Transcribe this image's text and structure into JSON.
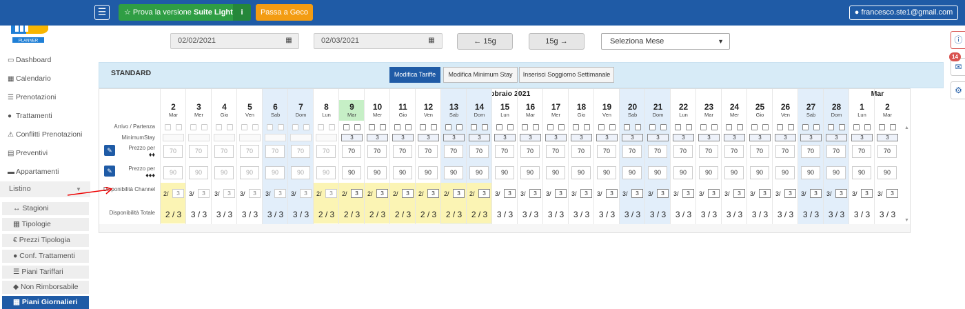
{
  "topbar": {
    "menu_icon": "hamburger-icon",
    "suite_label": "Prova la versione",
    "suite_strong": "Suite Light",
    "suite_info_icon": "info-icon",
    "geco_label": "Passa a Geco",
    "user_label": "francesco.ste1@gmail.com",
    "user_icon": "user-icon"
  },
  "sidebar": {
    "items": [
      {
        "icon": "monitor-icon",
        "label": "Dashboard"
      },
      {
        "icon": "calendar-icon",
        "label": "Calendario"
      },
      {
        "icon": "list-icon",
        "label": "Prenotazioni"
      },
      {
        "icon": "apple-icon",
        "label": "Trattamenti"
      },
      {
        "icon": "warning-icon",
        "label": "Conflitti Prenotazioni"
      },
      {
        "icon": "document-icon",
        "label": "Preventivi"
      },
      {
        "icon": "bed-icon",
        "label": "Appartamenti"
      }
    ],
    "listino_label": "Listino",
    "sub_items": [
      {
        "icon": "arrows-icon",
        "label": "Stagioni"
      },
      {
        "icon": "grid-icon",
        "label": "Tipologie"
      },
      {
        "icon": "euro-icon",
        "label": "Prezzi Tipologia"
      },
      {
        "icon": "apple-icon",
        "label": "Conf. Trattamenti"
      },
      {
        "icon": "list-icon",
        "label": "Piani Tariffari"
      },
      {
        "icon": "tag-icon",
        "label": "Non Rimborsabile"
      },
      {
        "icon": "grid-icon",
        "label": "Piani Giornalieri"
      }
    ]
  },
  "controls": {
    "date_from": "02/02/2021",
    "date_to": "02/03/2021",
    "prev_label": "15g",
    "next_label": "15g",
    "month_select": "Seleziona Mese"
  },
  "right_badge": "14",
  "panel": {
    "title": "STANDARD",
    "tab_modifica_tariffe": "Modifica Tariffe",
    "tab_min_stay": "Modifica Minimum Stay",
    "tab_soggiorno": "Inserisci Soggiorno Settimanale"
  },
  "grid": {
    "month_feb": "Febbraio 2021",
    "month_mar": "Mar",
    "label_arrivo": "Arrivo / Partenza",
    "label_minstay": "MinimumStay",
    "label_prezzo": "Prezzo per",
    "label_dispo_channel": "Disponibilità Channel",
    "label_dispo_totale": "Disponibilità Totale",
    "days": [
      {
        "num": "2",
        "wk": "Mar",
        "past": true,
        "ms": "",
        "p1": "70",
        "p2": "90",
        "dc": "2/",
        "dv": "3",
        "tot": "2 / 3",
        "hl": true,
        "we": false
      },
      {
        "num": "3",
        "wk": "Mer",
        "past": true,
        "ms": "",
        "p1": "70",
        "p2": "90",
        "dc": "3/",
        "dv": "3",
        "tot": "3 / 3",
        "hl": false,
        "we": false
      },
      {
        "num": "4",
        "wk": "Gio",
        "past": true,
        "ms": "",
        "p1": "70",
        "p2": "90",
        "dc": "3/",
        "dv": "3",
        "tot": "3 / 3",
        "hl": false,
        "we": false
      },
      {
        "num": "5",
        "wk": "Ven",
        "past": true,
        "ms": "",
        "p1": "70",
        "p2": "90",
        "dc": "3/",
        "dv": "3",
        "tot": "3 / 3",
        "hl": false,
        "we": false
      },
      {
        "num": "6",
        "wk": "Sab",
        "past": true,
        "ms": "",
        "p1": "70",
        "p2": "90",
        "dc": "3/",
        "dv": "3",
        "tot": "3 / 3",
        "hl": false,
        "we": true
      },
      {
        "num": "7",
        "wk": "Dom",
        "past": true,
        "ms": "",
        "p1": "70",
        "p2": "90",
        "dc": "3/",
        "dv": "3",
        "tot": "3 / 3",
        "hl": false,
        "we": true
      },
      {
        "num": "8",
        "wk": "Lun",
        "past": true,
        "ms": "",
        "p1": "70",
        "p2": "90",
        "dc": "2/",
        "dv": "3",
        "tot": "2 / 3",
        "hl": true,
        "we": false
      },
      {
        "num": "9",
        "wk": "Mar",
        "past": false,
        "ms": "3",
        "p1": "70",
        "p2": "90",
        "dc": "2/",
        "dv": "3",
        "tot": "2 / 3",
        "hl": true,
        "we": false,
        "today": true
      },
      {
        "num": "10",
        "wk": "Mer",
        "past": false,
        "ms": "3",
        "p1": "70",
        "p2": "90",
        "dc": "2/",
        "dv": "3",
        "tot": "2 / 3",
        "hl": true,
        "we": false
      },
      {
        "num": "11",
        "wk": "Gio",
        "past": false,
        "ms": "3",
        "p1": "70",
        "p2": "90",
        "dc": "2/",
        "dv": "3",
        "tot": "2 / 3",
        "hl": true,
        "we": false
      },
      {
        "num": "12",
        "wk": "Ven",
        "past": false,
        "ms": "3",
        "p1": "70",
        "p2": "90",
        "dc": "2/",
        "dv": "3",
        "tot": "2 / 3",
        "hl": true,
        "we": false
      },
      {
        "num": "13",
        "wk": "Sab",
        "past": false,
        "ms": "3",
        "p1": "70",
        "p2": "90",
        "dc": "2/",
        "dv": "3",
        "tot": "2 / 3",
        "hl": true,
        "we": true
      },
      {
        "num": "14",
        "wk": "Dom",
        "past": false,
        "ms": "3",
        "p1": "70",
        "p2": "90",
        "dc": "2/",
        "dv": "3",
        "tot": "2 / 3",
        "hl": true,
        "we": true
      },
      {
        "num": "15",
        "wk": "Lun",
        "past": false,
        "ms": "3",
        "p1": "70",
        "p2": "90",
        "dc": "3/",
        "dv": "3",
        "tot": "3 / 3",
        "hl": false,
        "we": false
      },
      {
        "num": "16",
        "wk": "Mar",
        "past": false,
        "ms": "3",
        "p1": "70",
        "p2": "90",
        "dc": "3/",
        "dv": "3",
        "tot": "3 / 3",
        "hl": false,
        "we": false
      },
      {
        "num": "17",
        "wk": "Mer",
        "past": false,
        "ms": "3",
        "p1": "70",
        "p2": "90",
        "dc": "3/",
        "dv": "3",
        "tot": "3 / 3",
        "hl": false,
        "we": false
      },
      {
        "num": "18",
        "wk": "Gio",
        "past": false,
        "ms": "3",
        "p1": "70",
        "p2": "90",
        "dc": "3/",
        "dv": "3",
        "tot": "3 / 3",
        "hl": false,
        "we": false
      },
      {
        "num": "19",
        "wk": "Ven",
        "past": false,
        "ms": "3",
        "p1": "70",
        "p2": "90",
        "dc": "3/",
        "dv": "3",
        "tot": "3 / 3",
        "hl": false,
        "we": false
      },
      {
        "num": "20",
        "wk": "Sab",
        "past": false,
        "ms": "3",
        "p1": "70",
        "p2": "90",
        "dc": "3/",
        "dv": "3",
        "tot": "3 / 3",
        "hl": false,
        "we": true
      },
      {
        "num": "21",
        "wk": "Dom",
        "past": false,
        "ms": "3",
        "p1": "70",
        "p2": "90",
        "dc": "3/",
        "dv": "3",
        "tot": "3 / 3",
        "hl": false,
        "we": true
      },
      {
        "num": "22",
        "wk": "Lun",
        "past": false,
        "ms": "3",
        "p1": "70",
        "p2": "90",
        "dc": "3/",
        "dv": "3",
        "tot": "3 / 3",
        "hl": false,
        "we": false
      },
      {
        "num": "23",
        "wk": "Mar",
        "past": false,
        "ms": "3",
        "p1": "70",
        "p2": "90",
        "dc": "3/",
        "dv": "3",
        "tot": "3 / 3",
        "hl": false,
        "we": false
      },
      {
        "num": "24",
        "wk": "Mer",
        "past": false,
        "ms": "3",
        "p1": "70",
        "p2": "90",
        "dc": "3/",
        "dv": "3",
        "tot": "3 / 3",
        "hl": false,
        "we": false
      },
      {
        "num": "25",
        "wk": "Gio",
        "past": false,
        "ms": "3",
        "p1": "70",
        "p2": "90",
        "dc": "3/",
        "dv": "3",
        "tot": "3 / 3",
        "hl": false,
        "we": false
      },
      {
        "num": "26",
        "wk": "Ven",
        "past": false,
        "ms": "3",
        "p1": "70",
        "p2": "90",
        "dc": "3/",
        "dv": "3",
        "tot": "3 / 3",
        "hl": false,
        "we": false
      },
      {
        "num": "27",
        "wk": "Sab",
        "past": false,
        "ms": "3",
        "p1": "70",
        "p2": "90",
        "dc": "3/",
        "dv": "3",
        "tot": "3 / 3",
        "hl": false,
        "we": true
      },
      {
        "num": "28",
        "wk": "Dom",
        "past": false,
        "ms": "3",
        "p1": "70",
        "p2": "90",
        "dc": "3/",
        "dv": "3",
        "tot": "3 / 3",
        "hl": false,
        "we": true
      },
      {
        "num": "1",
        "wk": "Lun",
        "past": false,
        "ms": "3",
        "p1": "70",
        "p2": "90",
        "dc": "3/",
        "dv": "3",
        "tot": "3 / 3",
        "hl": false,
        "we": false
      },
      {
        "num": "2",
        "wk": "Mar",
        "past": false,
        "ms": "3",
        "p1": "70",
        "p2": "90",
        "dc": "3/",
        "dv": "3",
        "tot": "3 / 3",
        "hl": false,
        "we": false
      }
    ]
  },
  "colors": {
    "primary": "#1f5ba6",
    "green": "#2f9e44",
    "orange": "#f39c12",
    "highlight_yellow": "#fbf4b4",
    "weekend_blue": "#e2eefa",
    "today_green": "#c6efc6"
  }
}
